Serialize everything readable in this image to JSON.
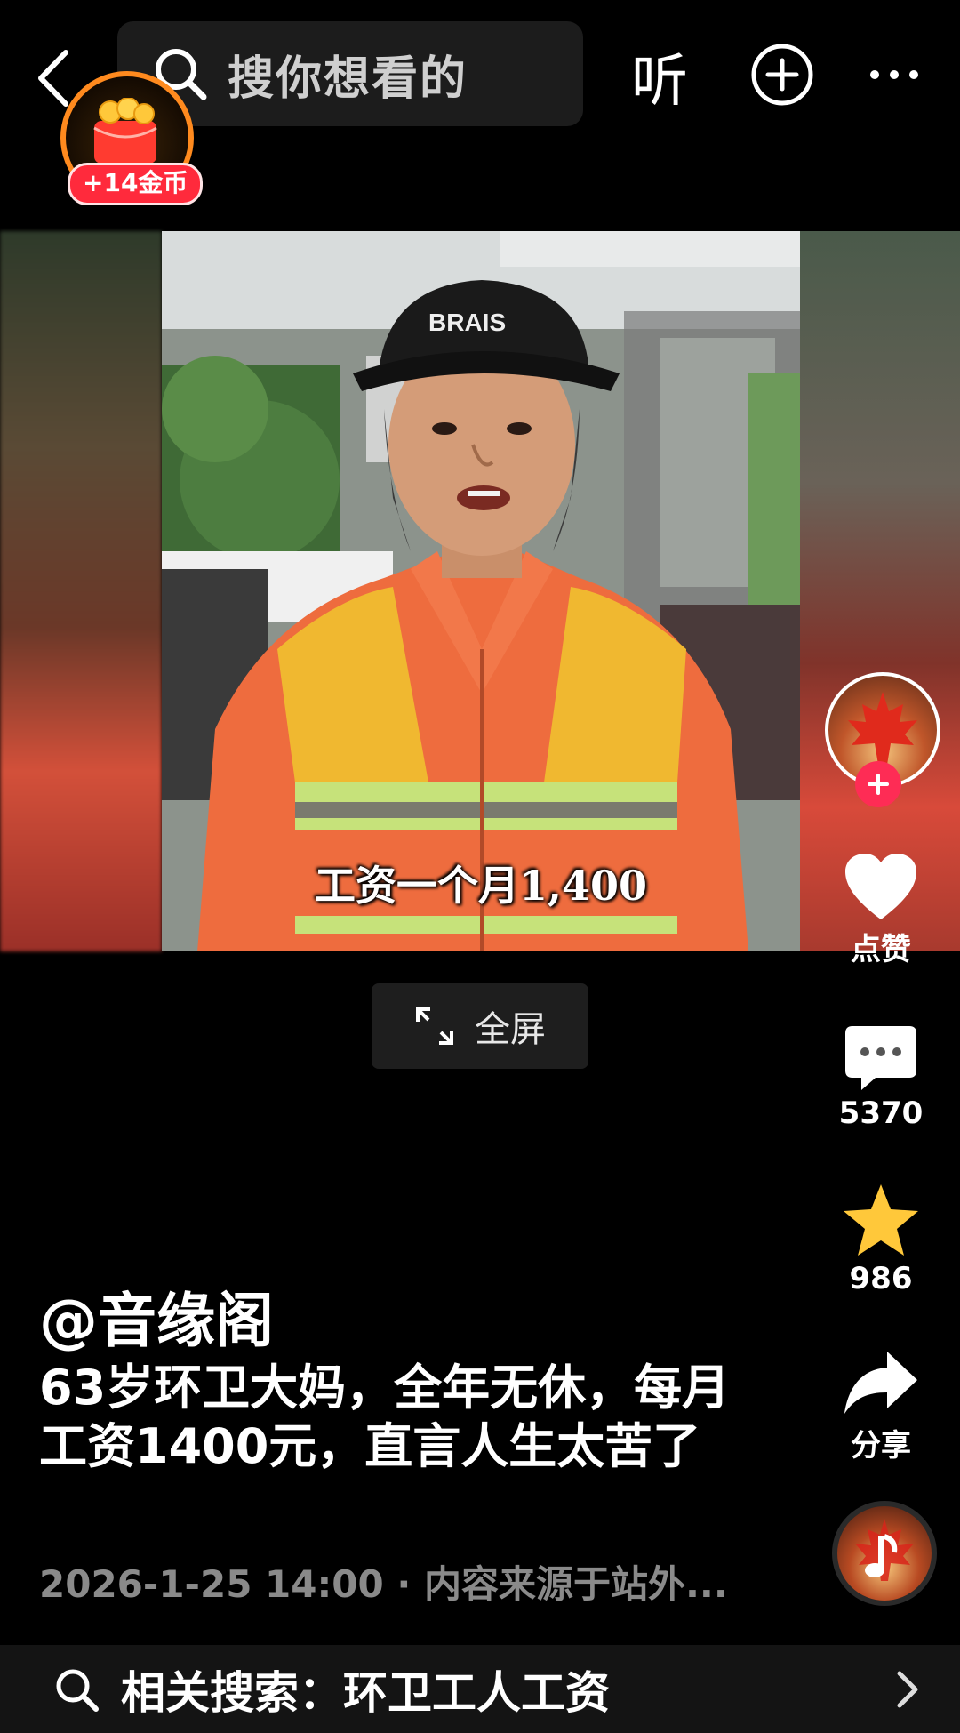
{
  "topbar": {
    "search_placeholder": "搜你想看的",
    "listen_label": "听"
  },
  "coin_reward": {
    "badge": "+14金币"
  },
  "video": {
    "subtitle": "工资一个月1,400",
    "fullscreen_label": "全屏"
  },
  "actions": {
    "like_label": "点赞",
    "comment_count": "5370",
    "favorite_count": "986",
    "share_label": "分享"
  },
  "post": {
    "author": "@音缘阁",
    "description": "63岁环卫大妈，全年无休，每月工资1400元，直言人生太苦了",
    "meta": "2026-1-25 14:00 · 内容来源于站外..."
  },
  "related_search": {
    "label": "相关搜索：环卫工人工资"
  },
  "colors": {
    "accent_red": "#fe2c55",
    "star_yellow": "#ffc83a",
    "coin_orange": "#ff8a1e"
  }
}
